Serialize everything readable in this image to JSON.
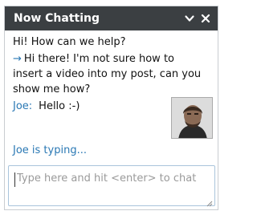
{
  "header": {
    "title": "Now Chatting",
    "minimize_icon": "chevron-down-icon",
    "close_icon": "close-icon"
  },
  "messages": [
    {
      "sender": "",
      "text": "Hi! How can we help?"
    },
    {
      "sender": "",
      "marker": "→",
      "text": "Hi there! I'm not sure how to insert a video into my post, can you show me how?"
    },
    {
      "sender": "Joe:",
      "text": "Hello :-)"
    }
  ],
  "agent": {
    "avatar_icon": "user-photo"
  },
  "status": {
    "typing": "Joe is typing..."
  },
  "input": {
    "placeholder": "Type here and hit <enter> to chat",
    "value": ""
  },
  "colors": {
    "header_bg": "#3b3f42",
    "accent": "#2a78b4"
  }
}
